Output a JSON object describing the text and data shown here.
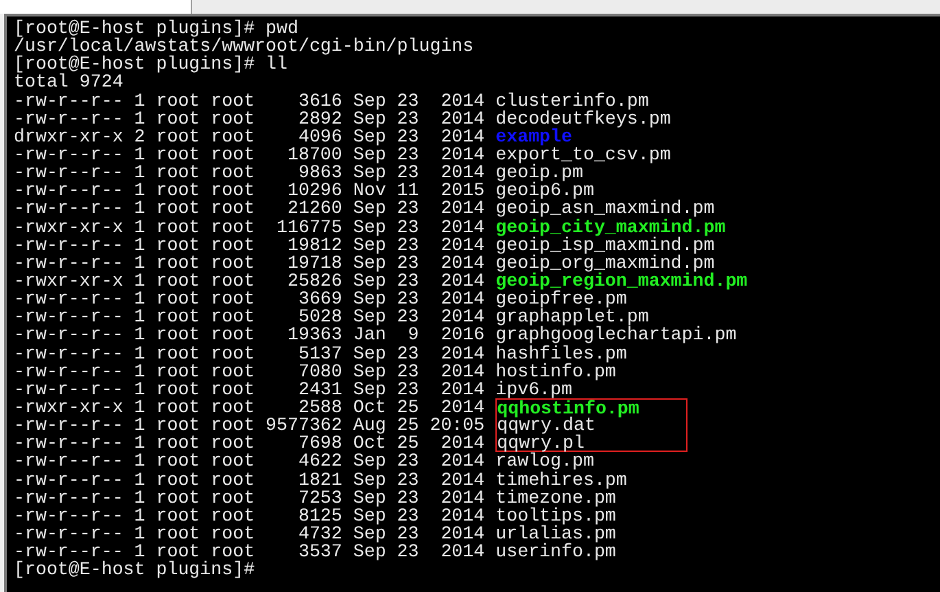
{
  "lines": [
    {
      "kind": "text",
      "text": "[root@E-host plugins]# pwd"
    },
    {
      "kind": "text",
      "text": "/usr/local/awstats/wwwroot/cgi-bin/plugins"
    },
    {
      "kind": "text",
      "text": "[root@E-host plugins]# ll"
    },
    {
      "kind": "text",
      "text": "total 9724"
    },
    {
      "kind": "file",
      "info": "-rw-r--r-- 1 root root    3616 Sep 23  2014",
      "name": "clusterinfo.pm",
      "highlighted": false
    },
    {
      "kind": "file",
      "info": "-rw-r--r-- 1 root root    2892 Sep 23  2014",
      "name": "decodeutfkeys.pm",
      "highlighted": false
    },
    {
      "kind": "dir",
      "info": "drwxr-xr-x 2 root root    4096 Sep 23  2014",
      "name": "example",
      "highlighted": false
    },
    {
      "kind": "file",
      "info": "-rw-r--r-- 1 root root   18700 Sep 23  2014",
      "name": "export_to_csv.pm",
      "highlighted": false
    },
    {
      "kind": "file",
      "info": "-rw-r--r-- 1 root root    9863 Sep 23  2014",
      "name": "geoip.pm",
      "highlighted": false
    },
    {
      "kind": "file",
      "info": "-rw-r--r-- 1 root root   10296 Nov 11  2015",
      "name": "geoip6.pm",
      "highlighted": false
    },
    {
      "kind": "file",
      "info": "-rw-r--r-- 1 root root   21260 Sep 23  2014",
      "name": "geoip_asn_maxmind.pm",
      "highlighted": false
    },
    {
      "kind": "exec",
      "info": "-rwxr-xr-x 1 root root  116775 Sep 23  2014",
      "name": "geoip_city_maxmind.pm",
      "highlighted": false
    },
    {
      "kind": "file",
      "info": "-rw-r--r-- 1 root root   19812 Sep 23  2014",
      "name": "geoip_isp_maxmind.pm",
      "highlighted": false
    },
    {
      "kind": "file",
      "info": "-rw-r--r-- 1 root root   19718 Sep 23  2014",
      "name": "geoip_org_maxmind.pm",
      "highlighted": false
    },
    {
      "kind": "exec",
      "info": "-rwxr-xr-x 1 root root   25826 Sep 23  2014",
      "name": "geoip_region_maxmind.pm",
      "highlighted": false
    },
    {
      "kind": "file",
      "info": "-rw-r--r-- 1 root root    3669 Sep 23  2014",
      "name": "geoipfree.pm",
      "highlighted": false
    },
    {
      "kind": "file",
      "info": "-rw-r--r-- 1 root root    5028 Sep 23  2014",
      "name": "graphapplet.pm",
      "highlighted": false
    },
    {
      "kind": "file",
      "info": "-rw-r--r-- 1 root root   19363 Jan  9  2016",
      "name": "graphgooglechartapi.pm",
      "highlighted": false
    },
    {
      "kind": "file",
      "info": "-rw-r--r-- 1 root root    5137 Sep 23  2014",
      "name": "hashfiles.pm",
      "highlighted": false
    },
    {
      "kind": "file",
      "info": "-rw-r--r-- 1 root root    7080 Sep 23  2014",
      "name": "hostinfo.pm",
      "highlighted": false
    },
    {
      "kind": "file",
      "info": "-rw-r--r-- 1 root root    2431 Sep 23  2014",
      "name": "ipv6.pm",
      "highlighted": false
    },
    {
      "kind": "exec",
      "info": "-rwxr-xr-x 1 root root    2588 Oct 25  2014",
      "name": "qqhostinfo.pm",
      "highlighted": true
    },
    {
      "kind": "file",
      "info": "-rw-r--r-- 1 root root 9577362 Aug 25 20:05",
      "name": "qqwry.dat",
      "highlighted": true
    },
    {
      "kind": "file",
      "info": "-rw-r--r-- 1 root root    7698 Oct 25  2014",
      "name": "qqwry.pl",
      "highlighted": true
    },
    {
      "kind": "file",
      "info": "-rw-r--r-- 1 root root    4622 Sep 23  2014",
      "name": "rawlog.pm",
      "highlighted": false
    },
    {
      "kind": "file",
      "info": "-rw-r--r-- 1 root root    1821 Sep 23  2014",
      "name": "timehires.pm",
      "highlighted": false
    },
    {
      "kind": "file",
      "info": "-rw-r--r-- 1 root root    7253 Sep 23  2014",
      "name": "timezone.pm",
      "highlighted": false
    },
    {
      "kind": "file",
      "info": "-rw-r--r-- 1 root root    8125 Sep 23  2014",
      "name": "tooltips.pm",
      "highlighted": false
    },
    {
      "kind": "file",
      "info": "-rw-r--r-- 1 root root    4732 Sep 23  2014",
      "name": "urlalias.pm",
      "highlighted": false
    },
    {
      "kind": "file",
      "info": "-rw-r--r-- 1 root root    3537 Sep 23  2014",
      "name": "userinfo.pm",
      "highlighted": false
    },
    {
      "kind": "text",
      "text": "[root@E-host plugins]#"
    }
  ]
}
